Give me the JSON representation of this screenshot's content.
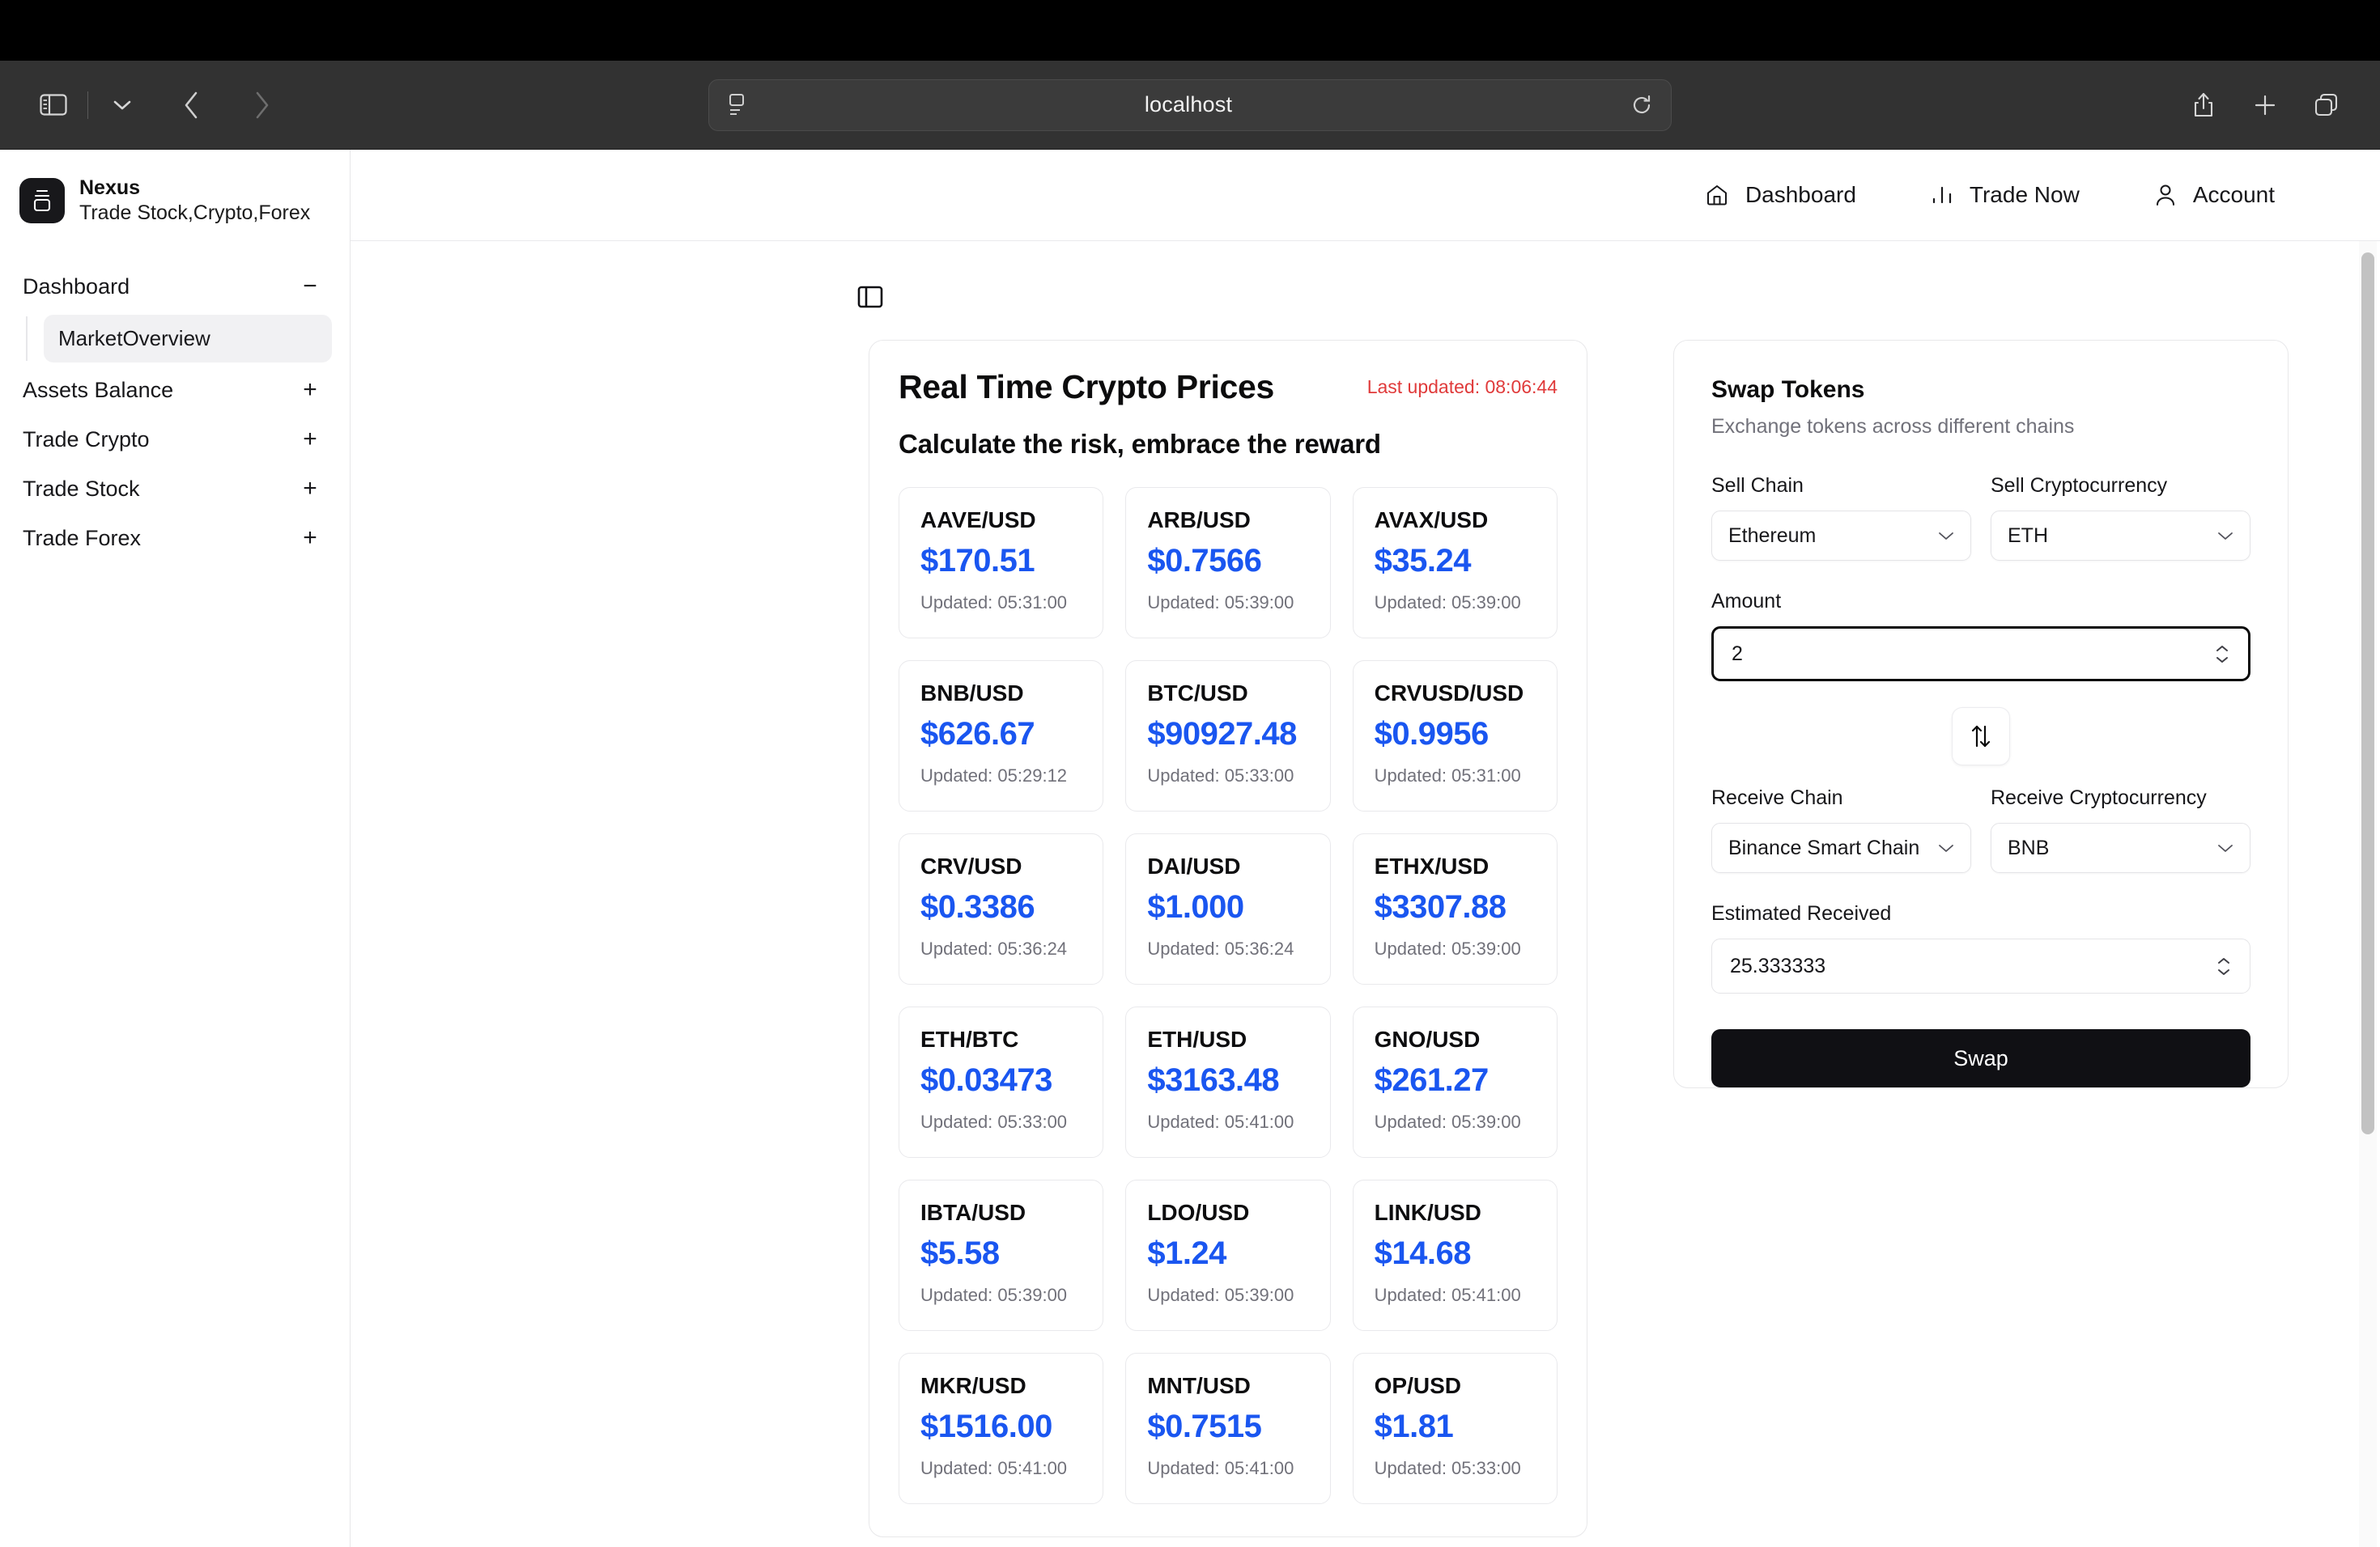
{
  "browser": {
    "url": "localhost",
    "sidebar_toggle_icon": "sidebar-toggle-icon",
    "tab_overview_icon": "chevron-down-icon",
    "back_icon": "chevron-left-icon",
    "forward_icon": "chevron-right-icon",
    "reader_icon": "reader-view-icon",
    "reload_icon": "reload-icon",
    "share_icon": "share-icon",
    "new_tab_icon": "plus-icon",
    "tabs_icon": "tab-overview-icon"
  },
  "sidebar": {
    "brand": {
      "name": "Nexus",
      "tagline": "Trade Stock,Crypto,Forex"
    },
    "groups": [
      {
        "label": "Dashboard",
        "toggle": "−",
        "expanded": true,
        "children": [
          {
            "label": "MarketOverview",
            "active": true
          }
        ]
      },
      {
        "label": "Assets Balance",
        "toggle": "+",
        "expanded": false,
        "children": []
      },
      {
        "label": "Trade Crypto",
        "toggle": "+",
        "expanded": false,
        "children": []
      },
      {
        "label": "Trade Stock",
        "toggle": "+",
        "expanded": false,
        "children": []
      },
      {
        "label": "Trade Forex",
        "toggle": "+",
        "expanded": false,
        "children": []
      }
    ]
  },
  "topnav": {
    "items": [
      {
        "label": "Dashboard",
        "icon": "home-icon"
      },
      {
        "label": "Trade Now",
        "icon": "bar-chart-icon"
      },
      {
        "label": "Account",
        "icon": "user-icon"
      }
    ]
  },
  "content": {
    "panel_toggle_icon": "panel-toggle-icon"
  },
  "prices": {
    "title": "Real Time Crypto Prices",
    "last_updated": "Last updated: 08:06:44",
    "subtitle": "Calculate the risk, embrace the reward",
    "accent_color": "#1a56f0",
    "updated_color": "#e03a3a",
    "items": [
      {
        "pair": "AAVE/USD",
        "price": "$170.51",
        "updated": "Updated: 05:31:00"
      },
      {
        "pair": "ARB/USD",
        "price": "$0.7566",
        "updated": "Updated: 05:39:00"
      },
      {
        "pair": "AVAX/USD",
        "price": "$35.24",
        "updated": "Updated: 05:39:00"
      },
      {
        "pair": "BNB/USD",
        "price": "$626.67",
        "updated": "Updated: 05:29:12"
      },
      {
        "pair": "BTC/USD",
        "price": "$90927.48",
        "updated": "Updated: 05:33:00"
      },
      {
        "pair": "CRVUSD/USD",
        "price": "$0.9956",
        "updated": "Updated: 05:31:00"
      },
      {
        "pair": "CRV/USD",
        "price": "$0.3386",
        "updated": "Updated: 05:36:24"
      },
      {
        "pair": "DAI/USD",
        "price": "$1.000",
        "updated": "Updated: 05:36:24"
      },
      {
        "pair": "ETHX/USD",
        "price": "$3307.88",
        "updated": "Updated: 05:39:00"
      },
      {
        "pair": "ETH/BTC",
        "price": "$0.03473",
        "updated": "Updated: 05:33:00"
      },
      {
        "pair": "ETH/USD",
        "price": "$3163.48",
        "updated": "Updated: 05:41:00"
      },
      {
        "pair": "GNO/USD",
        "price": "$261.27",
        "updated": "Updated: 05:39:00"
      },
      {
        "pair": "IBTA/USD",
        "price": "$5.58",
        "updated": "Updated: 05:39:00"
      },
      {
        "pair": "LDO/USD",
        "price": "$1.24",
        "updated": "Updated: 05:39:00"
      },
      {
        "pair": "LINK/USD",
        "price": "$14.68",
        "updated": "Updated: 05:41:00"
      },
      {
        "pair": "MKR/USD",
        "price": "$1516.00",
        "updated": "Updated: 05:41:00"
      },
      {
        "pair": "MNT/USD",
        "price": "$0.7515",
        "updated": "Updated: 05:41:00"
      },
      {
        "pair": "OP/USD",
        "price": "$1.81",
        "updated": "Updated: 05:33:00"
      }
    ]
  },
  "swap": {
    "title": "Swap Tokens",
    "subtitle": "Exchange tokens across different chains",
    "sell_chain": {
      "label": "Sell Chain",
      "value": "Ethereum"
    },
    "sell_crypto": {
      "label": "Sell Cryptocurrency",
      "value": "ETH"
    },
    "amount": {
      "label": "Amount",
      "value": "2"
    },
    "toggle_icon": "swap-vertical-icon",
    "receive_chain": {
      "label": "Receive Chain",
      "value": "Binance Smart Chain"
    },
    "receive_crypto": {
      "label": "Receive Cryptocurrency",
      "value": "BNB"
    },
    "estimated": {
      "label": "Estimated Received",
      "value": "25.333333"
    },
    "submit_label": "Swap"
  }
}
